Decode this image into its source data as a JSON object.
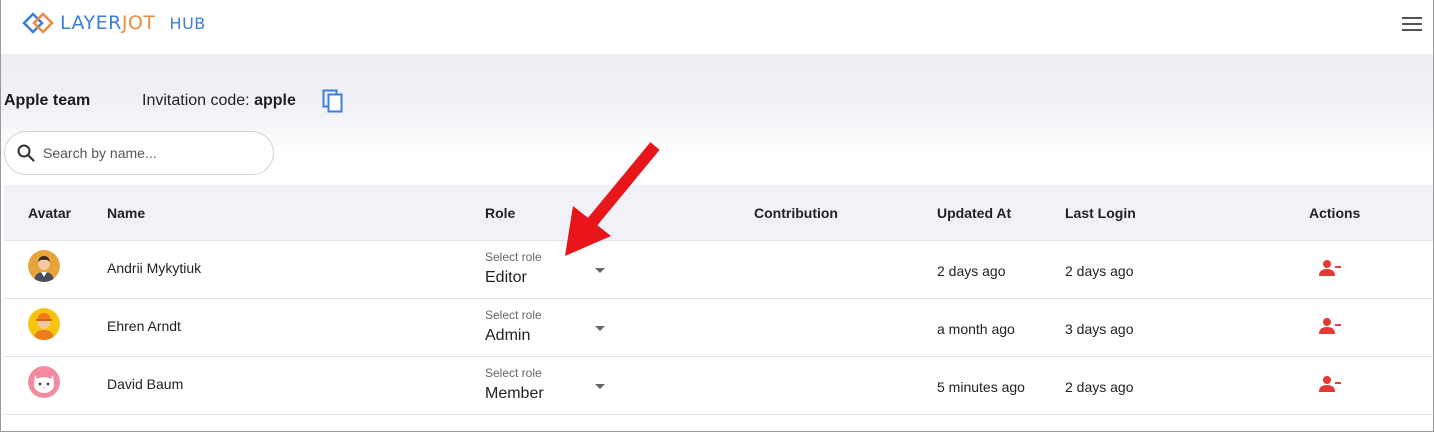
{
  "app": {
    "logo_left": "LAYER",
    "logo_right": "JOT",
    "hub_label": "HUB"
  },
  "team": {
    "name": "Apple team",
    "invitation_label": "Invitation code:",
    "invitation_code": "apple"
  },
  "search": {
    "placeholder": "Search by name...",
    "value": ""
  },
  "table": {
    "columns": [
      "Avatar",
      "Name",
      "Role",
      "Contribution",
      "Updated At",
      "Last Login",
      "Actions"
    ],
    "role_select_label": "Select role",
    "rows": [
      {
        "name": "Andrii Mykytiuk",
        "role": "Editor",
        "contribution": "",
        "updated_at": "2 days ago",
        "last_login": "2 days ago",
        "avatar": "man-avatar-icon"
      },
      {
        "name": "Ehren Arndt",
        "role": "Admin",
        "contribution": "",
        "updated_at": "a month ago",
        "last_login": "3 days ago",
        "avatar": "worker-avatar-icon"
      },
      {
        "name": "David Baum",
        "role": "Member",
        "contribution": "",
        "updated_at": "5 minutes ago",
        "last_login": "2 days ago",
        "avatar": "cat-avatar-icon"
      }
    ]
  },
  "colors": {
    "brand_blue": "#3b7fd9",
    "brand_orange": "#f08a3c",
    "danger": "#e53935",
    "header_bg": "#f1f2f7"
  },
  "icons": {
    "menu": "hamburger-menu-icon",
    "copy": "copy-icon",
    "search": "search-icon",
    "remove_user": "remove-user-icon",
    "caret": "chevron-down-icon"
  }
}
